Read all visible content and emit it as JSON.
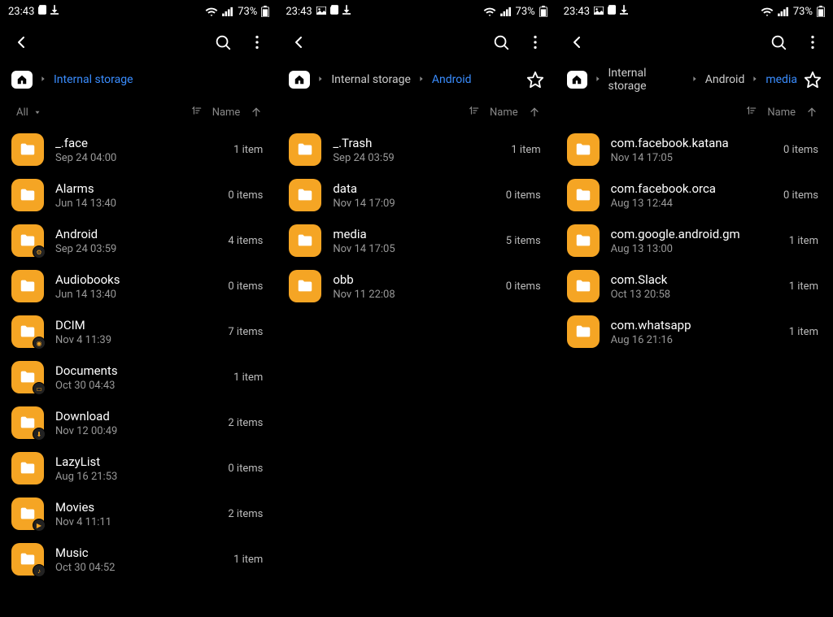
{
  "status": {
    "time": "23:43",
    "battery": "73%"
  },
  "sort": {
    "all": "All",
    "name": "Name"
  },
  "screens": [
    {
      "statusIcons": [
        "card",
        "download"
      ],
      "crumbs": [
        {
          "label": "Internal storage",
          "active": true
        }
      ],
      "showStar": false,
      "showAllFilter": true,
      "items": [
        {
          "name": "_.face",
          "date": "Sep 24 04:00",
          "count": "1 item",
          "badge": ""
        },
        {
          "name": "Alarms",
          "date": "Jun 14 13:40",
          "count": "0 items",
          "badge": ""
        },
        {
          "name": "Android",
          "date": "Sep 24 03:59",
          "count": "4 items",
          "badge": "⚙"
        },
        {
          "name": "Audiobooks",
          "date": "Jun 14 13:40",
          "count": "0 items",
          "badge": ""
        },
        {
          "name": "DCIM",
          "date": "Nov 4 11:39",
          "count": "7 items",
          "badge": "◉"
        },
        {
          "name": "Documents",
          "date": "Oct 30 04:43",
          "count": "1 item",
          "badge": "▭"
        },
        {
          "name": "Download",
          "date": "Nov 12 00:49",
          "count": "2 items",
          "badge": "⬇"
        },
        {
          "name": "LazyList",
          "date": "Aug 16 21:53",
          "count": "0 items",
          "badge": ""
        },
        {
          "name": "Movies",
          "date": "Nov 4 11:11",
          "count": "2 items",
          "badge": "▶"
        },
        {
          "name": "Music",
          "date": "Oct 30 04:52",
          "count": "1 item",
          "badge": "♪"
        }
      ]
    },
    {
      "statusIcons": [
        "image",
        "card",
        "download"
      ],
      "crumbs": [
        {
          "label": "Internal storage",
          "active": false
        },
        {
          "label": "Android",
          "active": true
        }
      ],
      "showStar": true,
      "showAllFilter": false,
      "items": [
        {
          "name": "_.Trash",
          "date": "Sep 24 03:59",
          "count": "1 item",
          "badge": ""
        },
        {
          "name": "data",
          "date": "Nov 14 17:09",
          "count": "0 items",
          "badge": ""
        },
        {
          "name": "media",
          "date": "Nov 14 17:05",
          "count": "5 items",
          "badge": ""
        },
        {
          "name": "obb",
          "date": "Nov 11 22:08",
          "count": "0 items",
          "badge": ""
        }
      ]
    },
    {
      "statusIcons": [
        "image",
        "card",
        "download"
      ],
      "crumbs": [
        {
          "label": "Internal storage",
          "active": false
        },
        {
          "label": "Android",
          "active": false
        },
        {
          "label": "media",
          "active": true
        }
      ],
      "showStar": true,
      "showAllFilter": false,
      "items": [
        {
          "name": "com.facebook.katana",
          "date": "Nov 14 17:05",
          "count": "0 items",
          "badge": ""
        },
        {
          "name": "com.facebook.orca",
          "date": "Aug 13 12:44",
          "count": "0 items",
          "badge": ""
        },
        {
          "name": "com.google.android.gm",
          "date": "Aug 13 13:00",
          "count": "1 item",
          "badge": ""
        },
        {
          "name": "com.Slack",
          "date": "Oct 13 20:58",
          "count": "1 item",
          "badge": ""
        },
        {
          "name": "com.whatsapp",
          "date": "Aug 16 21:16",
          "count": "1 item",
          "badge": ""
        }
      ]
    }
  ]
}
